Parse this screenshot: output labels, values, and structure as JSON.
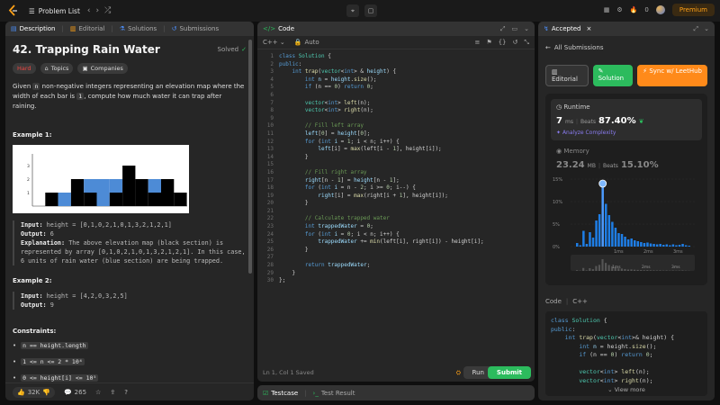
{
  "topbar": {
    "problem_list_label": "Problem List",
    "premium_label": "Premium",
    "streak_count": "0"
  },
  "description": {
    "tabs": [
      "Description",
      "Editorial",
      "Solutions",
      "Submissions"
    ],
    "title": "42. Trapping Rain Water",
    "solved_label": "Solved",
    "tags": [
      "Hard",
      "Topics",
      "Companies"
    ],
    "statement_pre": "Given ",
    "statement_code": "n",
    "statement_mid": " non-negative integers representing an elevation map where the width of each bar is ",
    "statement_code2": "1",
    "statement_post": ", compute how much water it can trap after raining.",
    "example1_title": "Example 1:",
    "example1_input_label": "Input:",
    "example1_input": "height = [0,1,0,2,1,0,1,3,2,1,2,1]",
    "example1_output_label": "Output:",
    "example1_output": "6",
    "example1_expl_label": "Explanation:",
    "example1_expl": "The above elevation map (black section) is represented by array [0,1,0,2,1,0,1,3,2,1,2,1]. In this case, 6 units of rain water (blue section) are being trapped.",
    "example2_title": "Example 2:",
    "example2_input_label": "Input:",
    "example2_input": "height = [4,2,0,3,2,5]",
    "example2_output_label": "Output:",
    "example2_output": "9",
    "constraints_title": "Constraints:",
    "constraints": [
      "n == height.length",
      "1 <= n <= 2 * 10⁴",
      "0 <= height[i] <= 10⁵"
    ],
    "footer": {
      "likes": "32K",
      "comments": "265"
    }
  },
  "elevation_chart": {
    "heights": [
      0,
      1,
      0,
      2,
      1,
      0,
      1,
      3,
      2,
      1,
      2,
      1
    ],
    "water": [
      0,
      0,
      1,
      0,
      1,
      2,
      1,
      0,
      0,
      1,
      0,
      0
    ],
    "y_ticks": [
      "1",
      "2",
      "3"
    ]
  },
  "code": {
    "header_title": "Code",
    "language": "C++",
    "auto_label": "Auto",
    "lines": [
      [
        [
          "kw",
          "class "
        ],
        [
          "ty",
          "Solution "
        ],
        [
          "pl",
          "{"
        ]
      ],
      [
        [
          "kw",
          "public"
        ],
        [
          "pl",
          ":"
        ]
      ],
      [
        [
          "pl",
          "    "
        ],
        [
          "kw",
          "int "
        ],
        [
          "fn",
          "trap"
        ],
        [
          "pl",
          "("
        ],
        [
          "ty",
          "vector"
        ],
        [
          "pl",
          "<"
        ],
        [
          "kw",
          "int"
        ],
        [
          "pl",
          "> & "
        ],
        [
          "var",
          "height"
        ],
        [
          "pl",
          ") {"
        ]
      ],
      [
        [
          "pl",
          "        "
        ],
        [
          "kw",
          "int "
        ],
        [
          "var",
          "n"
        ],
        [
          "pl",
          " = "
        ],
        [
          "var",
          "height"
        ],
        [
          "pl",
          "."
        ],
        [
          "fn",
          "size"
        ],
        [
          "pl",
          "();"
        ]
      ],
      [
        [
          "pl",
          "        "
        ],
        [
          "kw",
          "if "
        ],
        [
          "pl",
          "(n == "
        ],
        [
          "num",
          "0"
        ],
        [
          "pl",
          ") "
        ],
        [
          "kw",
          "return "
        ],
        [
          "num",
          "0"
        ],
        [
          "pl",
          ";"
        ]
      ],
      [
        [
          "pl",
          ""
        ]
      ],
      [
        [
          "pl",
          "        "
        ],
        [
          "ty",
          "vector"
        ],
        [
          "pl",
          "<"
        ],
        [
          "kw",
          "int"
        ],
        [
          "pl",
          "> "
        ],
        [
          "fn",
          "left"
        ],
        [
          "pl",
          "(n);"
        ]
      ],
      [
        [
          "pl",
          "        "
        ],
        [
          "ty",
          "vector"
        ],
        [
          "pl",
          "<"
        ],
        [
          "kw",
          "int"
        ],
        [
          "pl",
          "> "
        ],
        [
          "fn",
          "right"
        ],
        [
          "pl",
          "(n);"
        ]
      ],
      [
        [
          "pl",
          ""
        ]
      ],
      [
        [
          "pl",
          "        "
        ],
        [
          "cm",
          "// Fill left array"
        ]
      ],
      [
        [
          "pl",
          "        "
        ],
        [
          "var",
          "left"
        ],
        [
          "pl",
          "["
        ],
        [
          "num",
          "0"
        ],
        [
          "pl",
          "] = "
        ],
        [
          "var",
          "height"
        ],
        [
          "pl",
          "["
        ],
        [
          "num",
          "0"
        ],
        [
          "pl",
          "];"
        ]
      ],
      [
        [
          "pl",
          "        "
        ],
        [
          "kw",
          "for "
        ],
        [
          "pl",
          "("
        ],
        [
          "kw",
          "int "
        ],
        [
          "var",
          "i"
        ],
        [
          "pl",
          " = "
        ],
        [
          "num",
          "1"
        ],
        [
          "pl",
          "; i < n; i++) {"
        ]
      ],
      [
        [
          "pl",
          "            "
        ],
        [
          "var",
          "left"
        ],
        [
          "pl",
          "[i] = "
        ],
        [
          "fn",
          "max"
        ],
        [
          "pl",
          "(left[i - "
        ],
        [
          "num",
          "1"
        ],
        [
          "pl",
          "], height[i]);"
        ]
      ],
      [
        [
          "pl",
          "        }"
        ]
      ],
      [
        [
          "pl",
          ""
        ]
      ],
      [
        [
          "pl",
          "        "
        ],
        [
          "cm",
          "// Fill right array"
        ]
      ],
      [
        [
          "pl",
          "        "
        ],
        [
          "var",
          "right"
        ],
        [
          "pl",
          "[n - "
        ],
        [
          "num",
          "1"
        ],
        [
          "pl",
          "] = "
        ],
        [
          "var",
          "height"
        ],
        [
          "pl",
          "[n - "
        ],
        [
          "num",
          "1"
        ],
        [
          "pl",
          "];"
        ]
      ],
      [
        [
          "pl",
          "        "
        ],
        [
          "kw",
          "for "
        ],
        [
          "pl",
          "("
        ],
        [
          "kw",
          "int "
        ],
        [
          "var",
          "i"
        ],
        [
          "pl",
          " = n - "
        ],
        [
          "num",
          "2"
        ],
        [
          "pl",
          "; i >= "
        ],
        [
          "num",
          "0"
        ],
        [
          "pl",
          "; i--) {"
        ]
      ],
      [
        [
          "pl",
          "            "
        ],
        [
          "var",
          "right"
        ],
        [
          "pl",
          "[i] = "
        ],
        [
          "fn",
          "max"
        ],
        [
          "pl",
          "(right[i + "
        ],
        [
          "num",
          "1"
        ],
        [
          "pl",
          "], height[i]);"
        ]
      ],
      [
        [
          "pl",
          "        }"
        ]
      ],
      [
        [
          "pl",
          ""
        ]
      ],
      [
        [
          "pl",
          "        "
        ],
        [
          "cm",
          "// Calculate trapped water"
        ]
      ],
      [
        [
          "pl",
          "        "
        ],
        [
          "kw",
          "int "
        ],
        [
          "var",
          "trappedWater"
        ],
        [
          "pl",
          " = "
        ],
        [
          "num",
          "0"
        ],
        [
          "pl",
          ";"
        ]
      ],
      [
        [
          "pl",
          "        "
        ],
        [
          "kw",
          "for "
        ],
        [
          "pl",
          "("
        ],
        [
          "kw",
          "int "
        ],
        [
          "var",
          "i"
        ],
        [
          "pl",
          " = "
        ],
        [
          "num",
          "0"
        ],
        [
          "pl",
          "; i < n; i++) {"
        ]
      ],
      [
        [
          "pl",
          "            "
        ],
        [
          "var",
          "trappedWater"
        ],
        [
          "pl",
          " += "
        ],
        [
          "fn",
          "min"
        ],
        [
          "pl",
          "(left[i], right[i]) - height[i];"
        ]
      ],
      [
        [
          "pl",
          "        }"
        ]
      ],
      [
        [
          "pl",
          ""
        ]
      ],
      [
        [
          "pl",
          "        "
        ],
        [
          "kw",
          "return "
        ],
        [
          "var",
          "trappedWater"
        ],
        [
          "pl",
          ";"
        ]
      ],
      [
        [
          "pl",
          "    }"
        ]
      ],
      [
        [
          "pl",
          "};"
        ]
      ]
    ],
    "footer_status": "Ln 1, Col 1   Saved",
    "run_label": "Run",
    "submit_label": "Submit"
  },
  "testcase": {
    "tab1": "Testcase",
    "tab2": "Test Result"
  },
  "accepted": {
    "tab_label": "Accepted",
    "back_label": "All Submissions",
    "editorial_label": "Editorial",
    "solution_label": "Solution",
    "sync_label": "Sync w/ LeetHub",
    "runtime_label": "Runtime",
    "runtime_value": "7",
    "runtime_unit": "ms",
    "beats_label": "Beats",
    "runtime_beats": "87.40%",
    "analyze_label": "Analyze Complexity",
    "memory_label": "Memory",
    "memory_value": "23.24",
    "memory_unit": "MB",
    "memory_beats": "15.10%",
    "histogram_y_ticks": [
      "15%",
      "10%",
      "5%",
      "0%"
    ],
    "histogram_x_ticks": [
      "1ms",
      "2ms",
      "3ms"
    ],
    "mini_x_ticks": [
      "1ms",
      "2ms",
      "3ms"
    ],
    "histogram_bars": [
      0.8,
      0.3,
      3.5,
      0.6,
      3.2,
      2.0,
      5.8,
      7.2,
      14.0,
      9.5,
      7.0,
      5.5,
      4.2,
      3.0,
      2.8,
      2.2,
      1.6,
      1.8,
      1.4,
      1.2,
      1.0,
      0.8,
      0.9,
      0.7,
      0.6,
      0.5,
      0.6,
      0.4,
      0.5,
      0.3,
      0.5,
      0.3,
      0.4,
      0.6,
      0.3,
      0.2
    ],
    "highlight_bar_index": 8,
    "code_label": "Code",
    "code_lang": "C++",
    "snippet": [
      [
        [
          "kw",
          "class "
        ],
        [
          "ty",
          "Solution "
        ],
        [
          "pl",
          "{"
        ]
      ],
      [
        [
          "kw",
          "public"
        ],
        [
          "pl",
          ":"
        ]
      ],
      [
        [
          "pl",
          "    "
        ],
        [
          "kw",
          "int "
        ],
        [
          "fn",
          "trap"
        ],
        [
          "pl",
          "("
        ],
        [
          "ty",
          "vector"
        ],
        [
          "pl",
          "<"
        ],
        [
          "kw",
          "int"
        ],
        [
          "pl",
          ">& height) {"
        ]
      ],
      [
        [
          "pl",
          "        "
        ],
        [
          "kw",
          "int "
        ],
        [
          "var",
          "n"
        ],
        [
          "pl",
          " = height."
        ],
        [
          "fn",
          "size"
        ],
        [
          "pl",
          "();"
        ]
      ],
      [
        [
          "pl",
          "        "
        ],
        [
          "kw",
          "if "
        ],
        [
          "pl",
          "(n == "
        ],
        [
          "num",
          "0"
        ],
        [
          "pl",
          ") "
        ],
        [
          "kw",
          "return "
        ],
        [
          "num",
          "0"
        ],
        [
          "pl",
          ";"
        ]
      ],
      [
        [
          "pl",
          ""
        ]
      ],
      [
        [
          "pl",
          "        "
        ],
        [
          "ty",
          "vector"
        ],
        [
          "pl",
          "<"
        ],
        [
          "kw",
          "int"
        ],
        [
          "pl",
          "> "
        ],
        [
          "fn",
          "left"
        ],
        [
          "pl",
          "(n);"
        ]
      ],
      [
        [
          "pl",
          "        "
        ],
        [
          "ty",
          "vector"
        ],
        [
          "pl",
          "<"
        ],
        [
          "kw",
          "int"
        ],
        [
          "pl",
          "> "
        ],
        [
          "fn",
          "right"
        ],
        [
          "pl",
          "(n);"
        ]
      ]
    ],
    "view_more_label": "View more"
  },
  "colors": {
    "accent_green": "#2cbb5d",
    "accent_orange": "#ffa116",
    "hard_red": "#ef4743",
    "bar_blue": "#1e7ee6"
  }
}
